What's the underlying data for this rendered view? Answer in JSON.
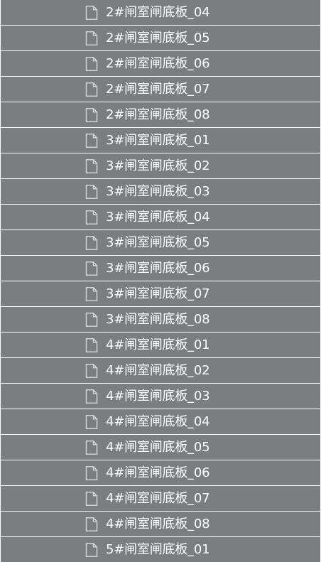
{
  "file_list": {
    "icon": "document-icon",
    "colors": {
      "row_background": "#7b7d80",
      "separator": "#ffffff",
      "label": "#ffffff",
      "icon": "#cfd1d4"
    },
    "items": [
      {
        "label": "2#闸室闸底板_04"
      },
      {
        "label": "2#闸室闸底板_05"
      },
      {
        "label": "2#闸室闸底板_06"
      },
      {
        "label": "2#闸室闸底板_07"
      },
      {
        "label": "2#闸室闸底板_08"
      },
      {
        "label": "3#闸室闸底板_01"
      },
      {
        "label": "3#闸室闸底板_02"
      },
      {
        "label": "3#闸室闸底板_03"
      },
      {
        "label": "3#闸室闸底板_04"
      },
      {
        "label": "3#闸室闸底板_05"
      },
      {
        "label": "3#闸室闸底板_06"
      },
      {
        "label": "3#闸室闸底板_07"
      },
      {
        "label": "3#闸室闸底板_08"
      },
      {
        "label": "4#闸室闸底板_01"
      },
      {
        "label": "4#闸室闸底板_02"
      },
      {
        "label": "4#闸室闸底板_03"
      },
      {
        "label": "4#闸室闸底板_04"
      },
      {
        "label": "4#闸室闸底板_05"
      },
      {
        "label": "4#闸室闸底板_06"
      },
      {
        "label": "4#闸室闸底板_07"
      },
      {
        "label": "4#闸室闸底板_08"
      },
      {
        "label": "5#闸室闸底板_01"
      }
    ]
  }
}
